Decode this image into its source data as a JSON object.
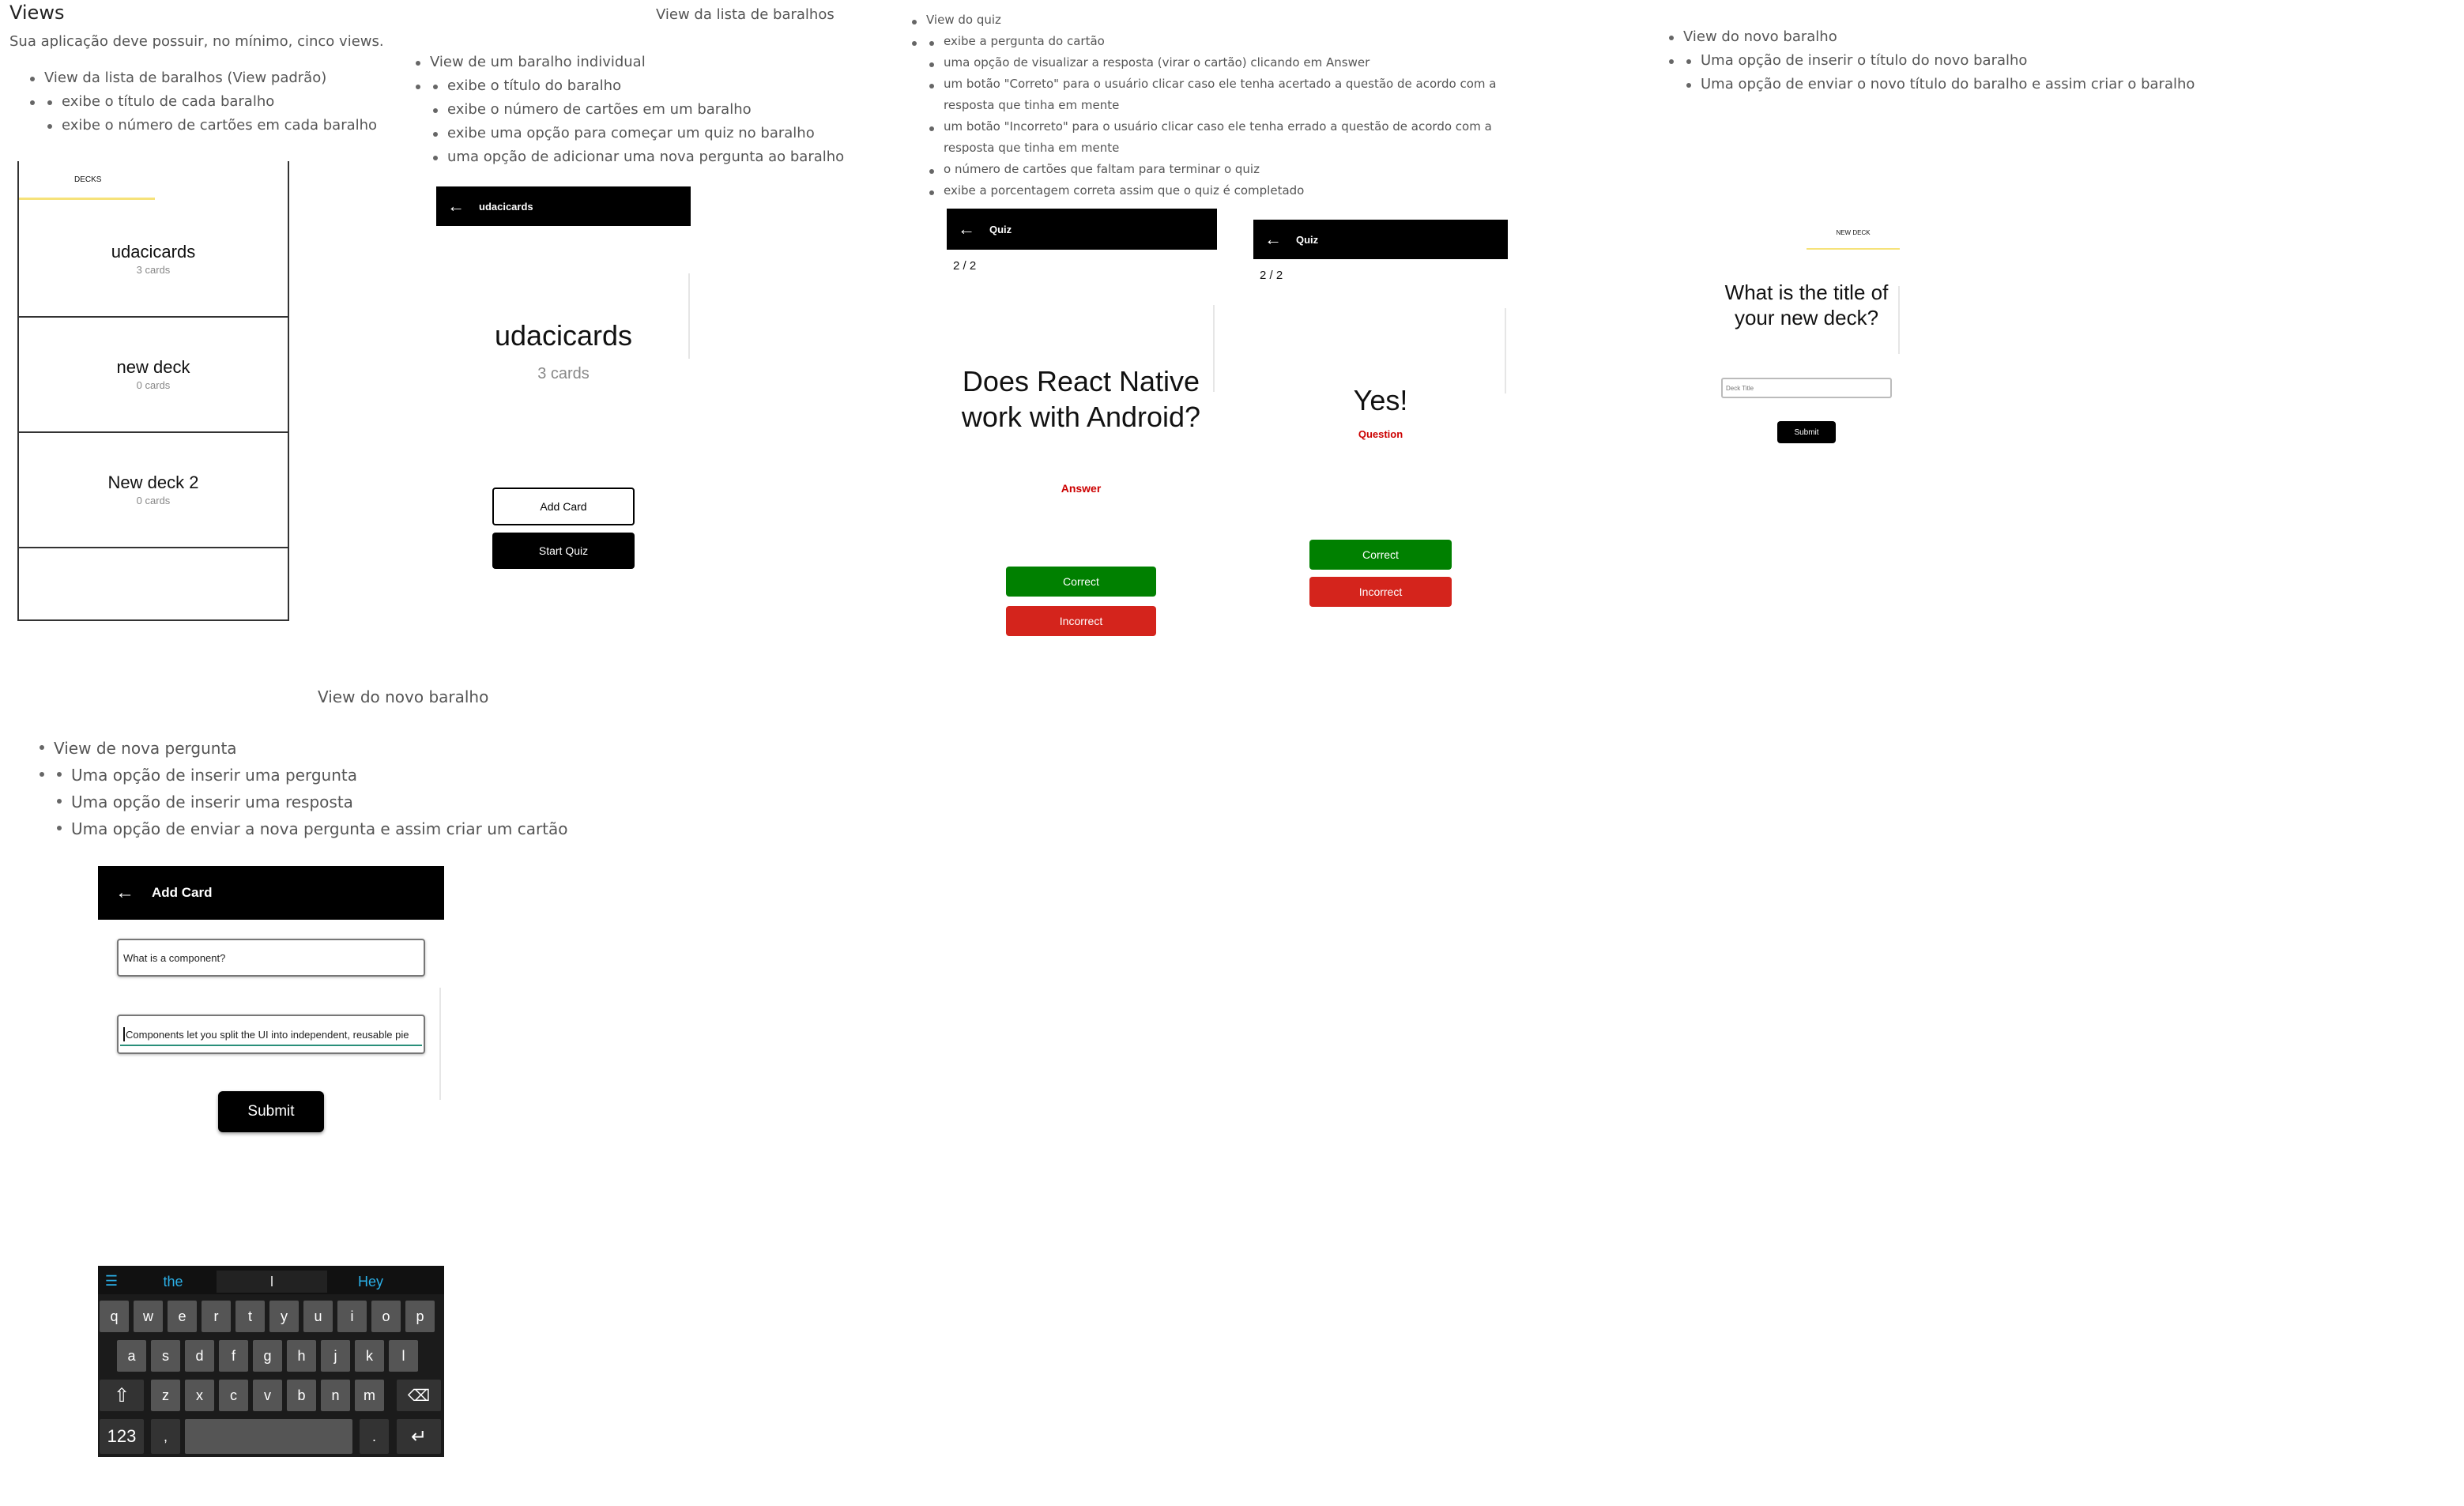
{
  "header": {
    "title": "Views",
    "subtitle": "Sua aplicação deve possuir, no mínimo, cinco views."
  },
  "section1": {
    "item": "View da lista de baralhos (View padrão)",
    "subitems": [
      "exibe o título de cada baralho",
      "exibe o número de cartões em cada baralho"
    ]
  },
  "section2": {
    "caption": "View da lista de baralhos",
    "item": "View de um baralho individual",
    "subitems": [
      "exibe o título do baralho",
      "exibe o número de cartões em um baralho",
      "exibe uma opção para começar um quiz no baralho",
      "uma opção de adicionar uma nova pergunta ao baralho"
    ]
  },
  "section3": {
    "item": "View do quiz",
    "subitems": [
      "exibe a pergunta do cartão",
      "uma opção de visualizar a resposta (virar o cartão) clicando em Answer",
      "um botão \"Correto\" para o usuário clicar caso ele tenha acertado a questão de acordo com a resposta que tinha em mente",
      "um botão \"Incorreto\" para o usuário clicar caso ele tenha errado a questão de acordo com a resposta que tinha em mente",
      "o número de cartões que faltam para terminar o quiz",
      "exibe a porcentagem correta assim que o quiz é completado"
    ]
  },
  "section4": {
    "item": "View do novo baralho",
    "subitems": [
      "Uma opção de inserir o título do novo baralho",
      "Uma opção de enviar o novo título do baralho e assim criar o baralho"
    ]
  },
  "section5": {
    "caption": "View do novo baralho",
    "item": "View de nova pergunta",
    "subitems": [
      "Uma opção de inserir uma pergunta",
      "Uma opção de inserir uma resposta",
      "Uma opção de enviar a nova pergunta e assim criar um cartão"
    ]
  },
  "deck_list": {
    "tab_label": "DECKS",
    "decks": [
      {
        "title": "udacicards",
        "count": "3 cards"
      },
      {
        "title": "new deck",
        "count": "0 cards"
      },
      {
        "title": "New deck 2",
        "count": "0 cards"
      }
    ]
  },
  "deck_view": {
    "bar_title": "udacicards",
    "title": "udacicards",
    "count": "3 cards",
    "add_card": "Add Card",
    "start_quiz": "Start Quiz"
  },
  "quiz_question": {
    "bar_title": "Quiz",
    "progress": "2 / 2",
    "question": "Does React Native work with Android?",
    "toggle": "Answer",
    "correct": "Correct",
    "incorrect": "Incorrect"
  },
  "quiz_answer": {
    "bar_title": "Quiz",
    "progress": "2 / 2",
    "answer": "Yes!",
    "toggle": "Question",
    "correct": "Correct",
    "incorrect": "Incorrect"
  },
  "new_deck": {
    "tab_label": "NEW DECK",
    "prompt": "What is the title of your new deck?",
    "placeholder": "Deck Title",
    "submit": "Submit"
  },
  "add_card": {
    "bar_title": "Add Card",
    "question_value": "What is a component?",
    "answer_value": "Components let you split the UI into independent, reusable pie",
    "submit": "Submit"
  },
  "keyboard": {
    "suggestions": [
      "the",
      "I",
      "Hey"
    ],
    "row1": [
      "q",
      "w",
      "e",
      "r",
      "t",
      "y",
      "u",
      "i",
      "o",
      "p"
    ],
    "row2": [
      "a",
      "s",
      "d",
      "f",
      "g",
      "h",
      "j",
      "k",
      "l"
    ],
    "row3": [
      "z",
      "x",
      "c",
      "v",
      "b",
      "n",
      "m"
    ],
    "numbers_key": "123",
    "comma": ",",
    "period": "."
  },
  "colors": {
    "correct": "#008000",
    "incorrect": "#d4241c",
    "accent_red": "#cc0000",
    "tab_underline": "#f6e27a",
    "keyboard_accent": "#2bb0e8"
  }
}
